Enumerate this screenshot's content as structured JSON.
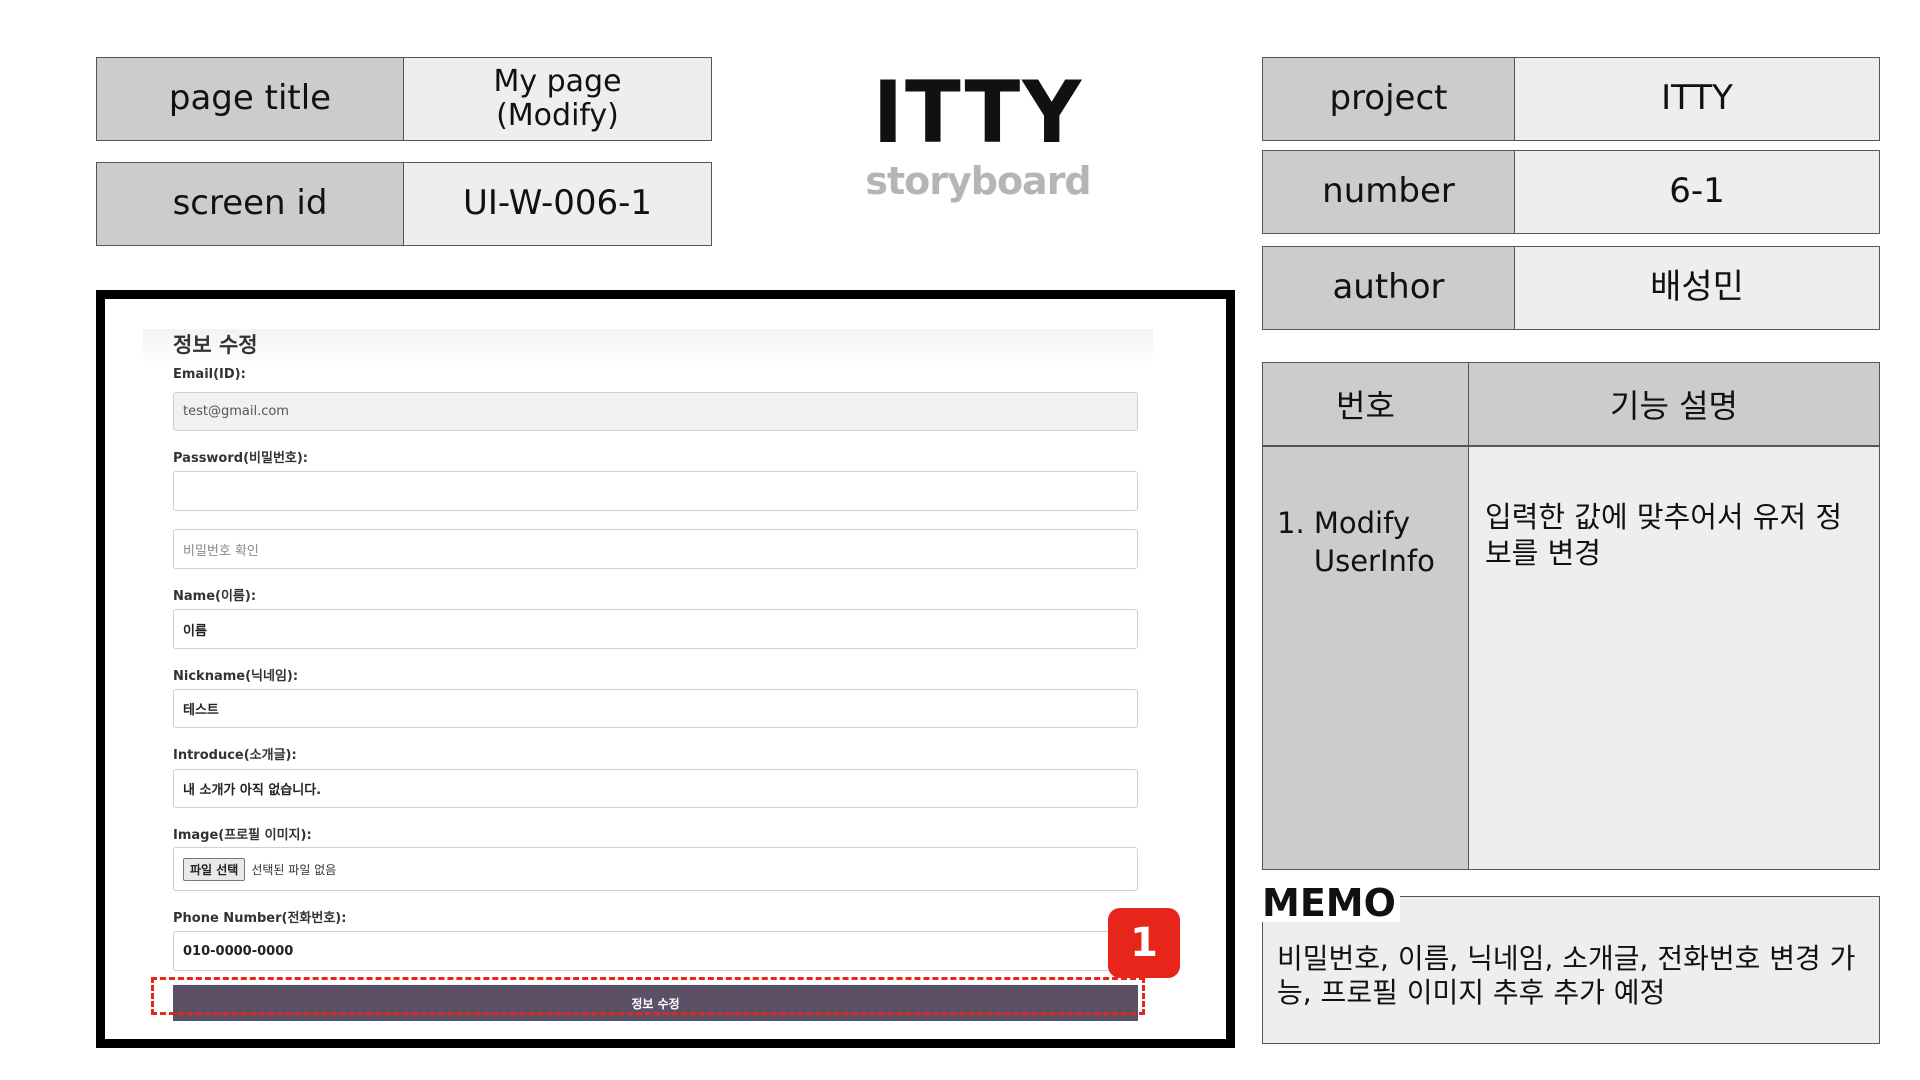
{
  "header": {
    "page_title_label": "page title",
    "page_title_value": "My page\n(Modify)",
    "screen_id_label": "screen id",
    "screen_id_value": "UI-W-006-1",
    "logo_main": "ITTY",
    "logo_sub": "storyboard",
    "project_label": "project",
    "project_value": "ITTY",
    "number_label": "number",
    "number_value": "6-1",
    "author_label": "author",
    "author_value": "배성민"
  },
  "form": {
    "title": "정보 수정",
    "email_label": "Email(ID):",
    "email_value": "test@gmail.com",
    "password_label": "Password(비밀번호):",
    "password_value": "",
    "password_confirm_placeholder": "비밀번호 확인",
    "name_label": "Name(이름):",
    "name_value": "이름",
    "nickname_label": "Nickname(닉네임):",
    "nickname_value": "테스트",
    "introduce_label": "Introduce(소개글):",
    "introduce_value": "내 소개가 아직 없습니다.",
    "image_label": "Image(프로필 이미지):",
    "file_button": "파일 선택",
    "file_status": "선택된 파일 없음",
    "phone_label": "Phone Number(전화번호):",
    "phone_value": "010-0000-0000",
    "submit_label": "정보 수정"
  },
  "annotation": {
    "badge": "1"
  },
  "function_table": {
    "col_number": "번호",
    "col_description": "기능 설명",
    "row_number": "1. Modify\n    UserInfo",
    "row_description": "입력한 값에 맞추어서 유저 정보를 변경"
  },
  "memo": {
    "title": "MEMO",
    "text": "비밀번호, 이름, 닉네임, 소개글, 전화번호 변경 가능, 프로필 이미지 추후 추가 예정"
  },
  "colors": {
    "label_bg": "#cccccc",
    "value_bg": "#eeeeee",
    "submit_bg": "#5b5065",
    "accent_red": "#e8251b"
  }
}
